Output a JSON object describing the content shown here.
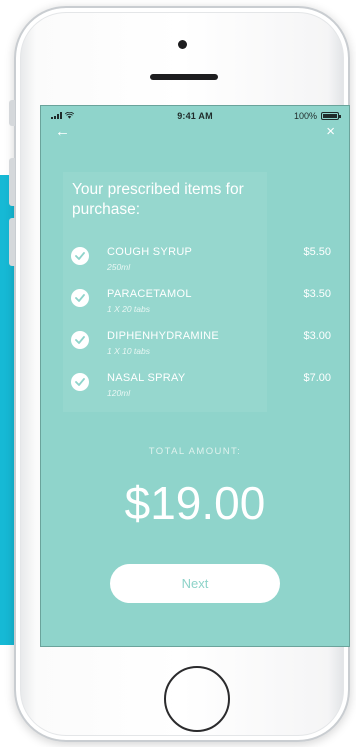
{
  "status_bar": {
    "time": "9:41 AM",
    "battery": "100%"
  },
  "colors": {
    "screen_background": "#8fd4cb",
    "accent_slab": "#16b9d5",
    "button_text": "#8ed3c9"
  },
  "nav": {
    "back_icon": "←",
    "close_icon": "×"
  },
  "purchase": {
    "title": "Your prescribed items for purchase:",
    "items": [
      {
        "name": "COUGH SYRUP",
        "detail": "250ml",
        "price": "$5.50",
        "checked": true
      },
      {
        "name": "PARACETAMOL",
        "detail": "1 X 20 tabs",
        "price": "$3.50",
        "checked": true
      },
      {
        "name": "DIPHENHYDRAMINE",
        "detail": "1 X 10 tabs",
        "price": "$3.00",
        "checked": true
      },
      {
        "name": "NASAL SPRAY",
        "detail": "120ml",
        "price": "$7.00",
        "checked": true
      }
    ]
  },
  "total": {
    "label": "TOTAL AMOUNT:",
    "amount": "$19.00"
  },
  "next_button": {
    "label": "Next"
  },
  "icons": {
    "signal": "signal-icon",
    "wifi": "wifi-icon",
    "battery": "battery-icon",
    "back": "back-arrow-icon",
    "close": "close-icon",
    "check": "check-circle-icon"
  }
}
